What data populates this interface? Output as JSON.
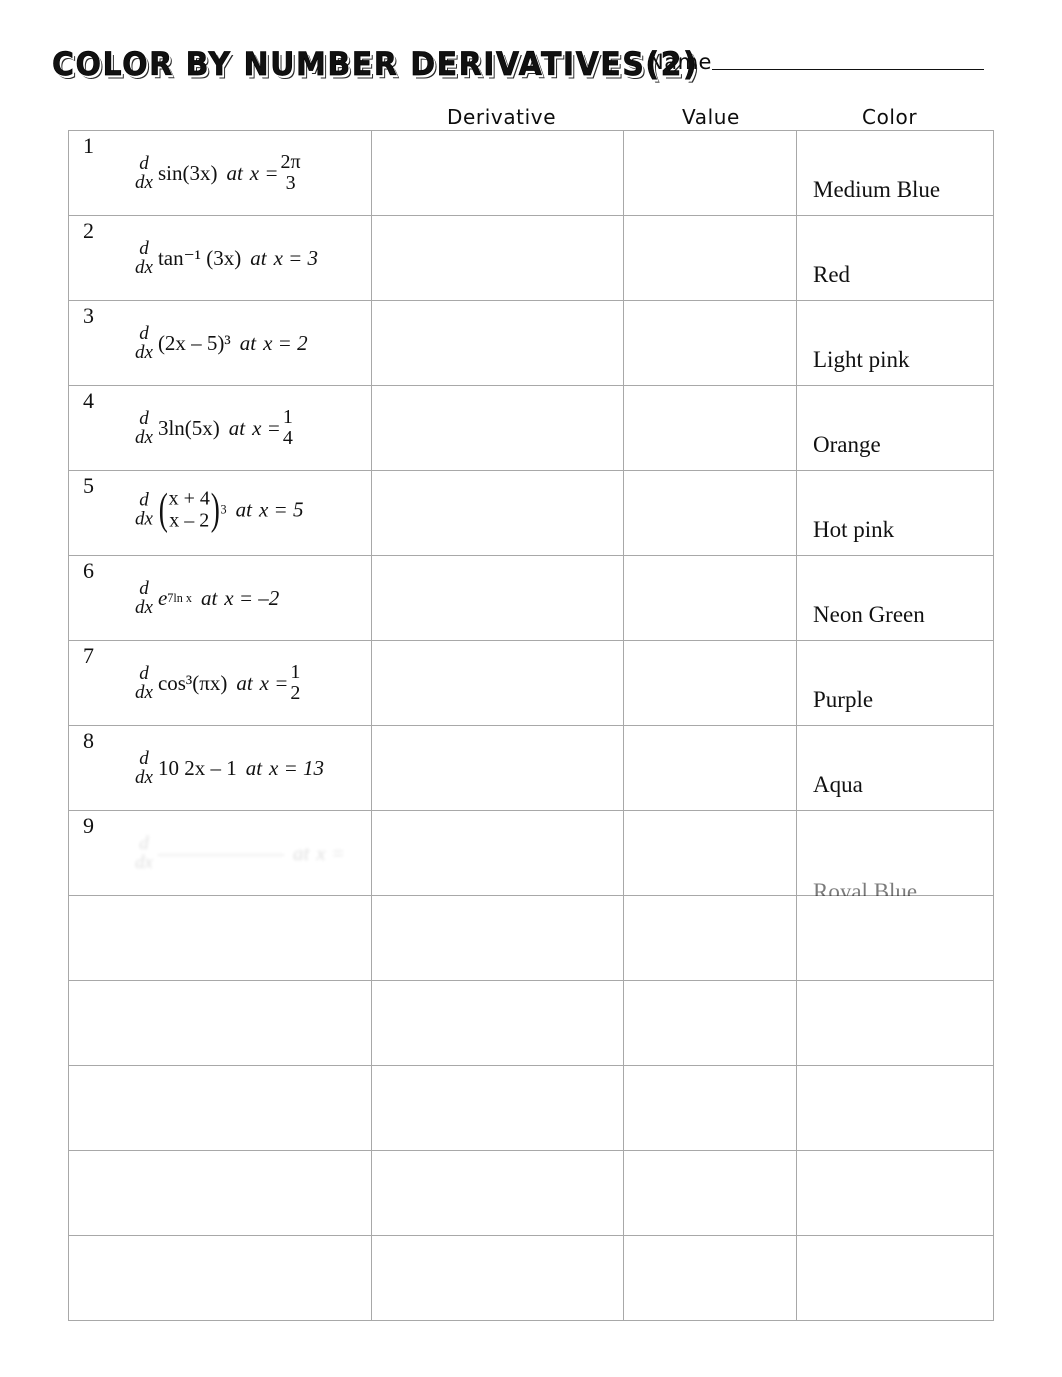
{
  "header": {
    "title": "COLOR BY NUMBER DERIVATIVES(2)",
    "name_label": "Name"
  },
  "columns": {
    "problem": "",
    "derivative": "Derivative",
    "value": "Value",
    "color": "Color"
  },
  "rows": [
    {
      "number": "1",
      "ddx_num": "d",
      "ddx_den": "dx",
      "body": "sin(3x)",
      "at": "at",
      "var": "x =",
      "at_value_num": "2π",
      "at_value_den": "3",
      "color": "Medium Blue",
      "derivative": "",
      "value": ""
    },
    {
      "number": "2",
      "ddx_num": "d",
      "ddx_den": "dx",
      "body": "tan⁻¹ (3x)",
      "at": "at",
      "var": "x = 3",
      "at_value_num": "",
      "at_value_den": "",
      "color": "Red",
      "derivative": "",
      "value": ""
    },
    {
      "number": "3",
      "ddx_num": "d",
      "ddx_den": "dx",
      "body": "(2x – 5)³",
      "at": "at",
      "var": "x = 2",
      "at_value_num": "",
      "at_value_den": "",
      "color": "Light pink",
      "derivative": "",
      "value": ""
    },
    {
      "number": "4",
      "ddx_num": "d",
      "ddx_den": "dx",
      "body": "3ln(5x)",
      "at": "at",
      "var": "x =",
      "at_value_num": "1",
      "at_value_den": "4",
      "color": "Orange",
      "derivative": "",
      "value": ""
    },
    {
      "number": "5",
      "ddx_num": "d",
      "ddx_den": "dx",
      "body_num": "x + 4",
      "body_den": "x – 2",
      "body_exp": "3",
      "at": "at",
      "var": "x = 5",
      "at_value_num": "",
      "at_value_den": "",
      "color": "Hot pink",
      "derivative": "",
      "value": ""
    },
    {
      "number": "6",
      "ddx_num": "d",
      "ddx_den": "dx",
      "body_base": "e",
      "body_exp": "7ln x",
      "at": "at",
      "var": "x = –2",
      "at_value_num": "",
      "at_value_den": "",
      "color": "Neon Green",
      "derivative": "",
      "value": ""
    },
    {
      "number": "7",
      "ddx_num": "d",
      "ddx_den": "dx",
      "body": "cos³(πx)",
      "at": "at",
      "var": "x =",
      "at_value_num": "1",
      "at_value_den": "2",
      "color": "Purple",
      "derivative": "",
      "value": ""
    },
    {
      "number": "8",
      "ddx_num": "d",
      "ddx_den": "dx",
      "body": "10  2x – 1",
      "at": "at",
      "var": "x = 13",
      "at_value_num": "",
      "at_value_den": "",
      "color": "Aqua",
      "derivative": "",
      "value": ""
    },
    {
      "number": "9",
      "ddx_num": "d",
      "ddx_den": "dx",
      "body": "——————",
      "at": "at",
      "var": "x =",
      "at_value_num": "",
      "at_value_den": "",
      "color": "Royal Blue",
      "derivative": "",
      "value": ""
    },
    {
      "number": "",
      "body": "",
      "color": "",
      "derivative": "",
      "value": ""
    },
    {
      "number": "",
      "body": "",
      "color": "",
      "derivative": "",
      "value": ""
    },
    {
      "number": "",
      "body": "",
      "color": "",
      "derivative": "",
      "value": ""
    },
    {
      "number": "",
      "body": "",
      "color": "",
      "derivative": "",
      "value": ""
    },
    {
      "number": "",
      "body": "",
      "color": "",
      "derivative": "",
      "value": ""
    }
  ],
  "footer": {
    "note": ""
  }
}
